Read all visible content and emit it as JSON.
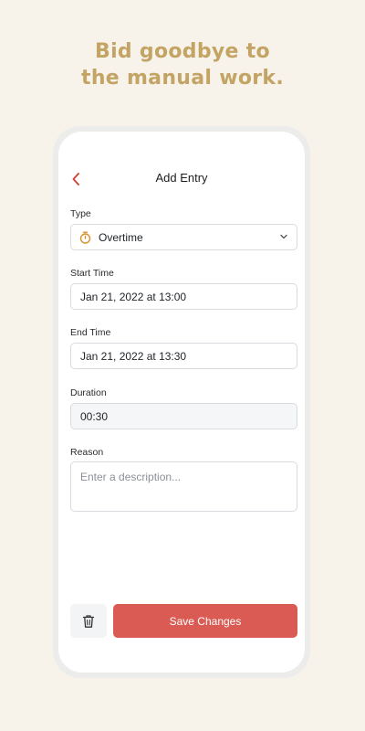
{
  "headline": {
    "line1": "Bid goodbye to",
    "line2": "the manual work."
  },
  "screen": {
    "title": "Add Entry",
    "icons": {
      "back": "chevron-left-icon",
      "timer": "stopwatch-icon",
      "dropdown": "chevron-down-icon",
      "delete": "trash-icon"
    },
    "type": {
      "label": "Type",
      "value": "Overtime"
    },
    "start_time": {
      "label": "Start Time",
      "value": "Jan 21, 2022 at 13:00"
    },
    "end_time": {
      "label": "End Time",
      "value": "Jan 21, 2022 at 13:30"
    },
    "duration": {
      "label": "Duration",
      "value": "00:30"
    },
    "reason": {
      "label": "Reason",
      "placeholder": "Enter a description..."
    },
    "save_label": "Save Changes"
  },
  "colors": {
    "background": "#f7f3ea",
    "headline": "#c4a464",
    "accent": "#d95b53",
    "timer_icon": "#d9902a"
  }
}
